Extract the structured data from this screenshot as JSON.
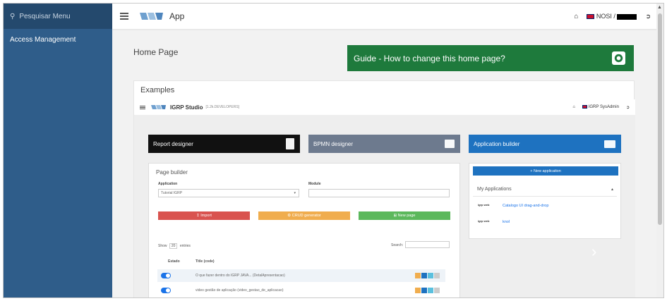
{
  "sidebar": {
    "search_placeholder": "Pesquisar Menu",
    "items": [
      {
        "label": "Access Management"
      }
    ]
  },
  "topbar": {
    "app_title": "App",
    "user": "NOSI /"
  },
  "main": {
    "page_title": "Home Page",
    "guide_button": "Guide - How to change this home page?",
    "examples_title": "Examples"
  },
  "preview": {
    "app_name": "IGRP Studio",
    "env": "[1.2k.DEVELOPERS]",
    "user": "IGRP SysAdmin",
    "cards": [
      {
        "label": "Report designer",
        "color": "#111111"
      },
      {
        "label": "BPMN designer",
        "color": "#6d7a8e"
      },
      {
        "label": "Application builder",
        "color": "#1e72c0"
      }
    ],
    "page_builder": {
      "title": "Page builder",
      "application_label": "Application",
      "application_value": "Tutorial IGRP",
      "module_label": "Module",
      "import_btn": "Import",
      "crud_btn": "CRUD generator",
      "new_page_btn": "New page",
      "show_label": "Show",
      "show_value": "20",
      "entries_label": "entries",
      "search_label": "Search:",
      "col_estado": "Estado",
      "col_title": "Title (code)",
      "rows": [
        {
          "title": "O que fazer dentro do IGRP JAVA... (DetalApresentacao)"
        },
        {
          "title": "video gestão de aplicação (video_gestao_de_aplicacao)"
        }
      ]
    },
    "apps_panel": {
      "new_app_btn": "New application",
      "my_apps_title": "My Applications",
      "apps": [
        {
          "logo": "igrp web",
          "name": "Catalogo UI drag-and-drop"
        },
        {
          "logo": "igrp web",
          "name": "knol"
        }
      ]
    }
  },
  "colors": {
    "sidebar": "#2f5d8a",
    "guide": "#1e7a3c",
    "import": "#d9534f",
    "crud": "#f0ad4e",
    "new_page": "#5cb85c",
    "app_blue": "#1e72c0"
  }
}
